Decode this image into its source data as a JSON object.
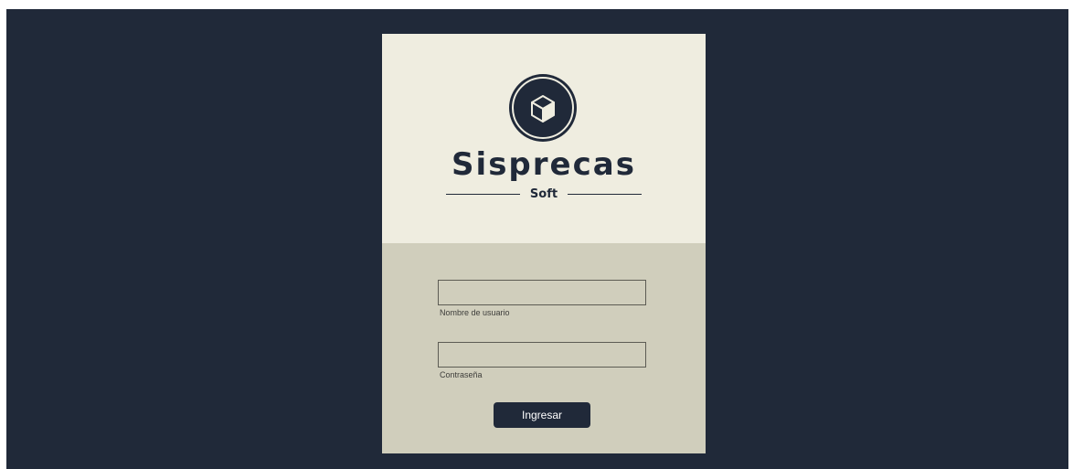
{
  "brand": {
    "name": "Sisprecas",
    "subtitle": "Soft",
    "logo_icon": "cube-icon"
  },
  "login_form": {
    "username": {
      "label": "Nombre de usuario",
      "value": ""
    },
    "password": {
      "label": "Contraseña",
      "value": ""
    },
    "submit_label": "Ingresar"
  },
  "colors": {
    "background": "#202939",
    "card_top": "#efede0",
    "card_bottom": "#d0cebc",
    "accent": "#202939"
  }
}
